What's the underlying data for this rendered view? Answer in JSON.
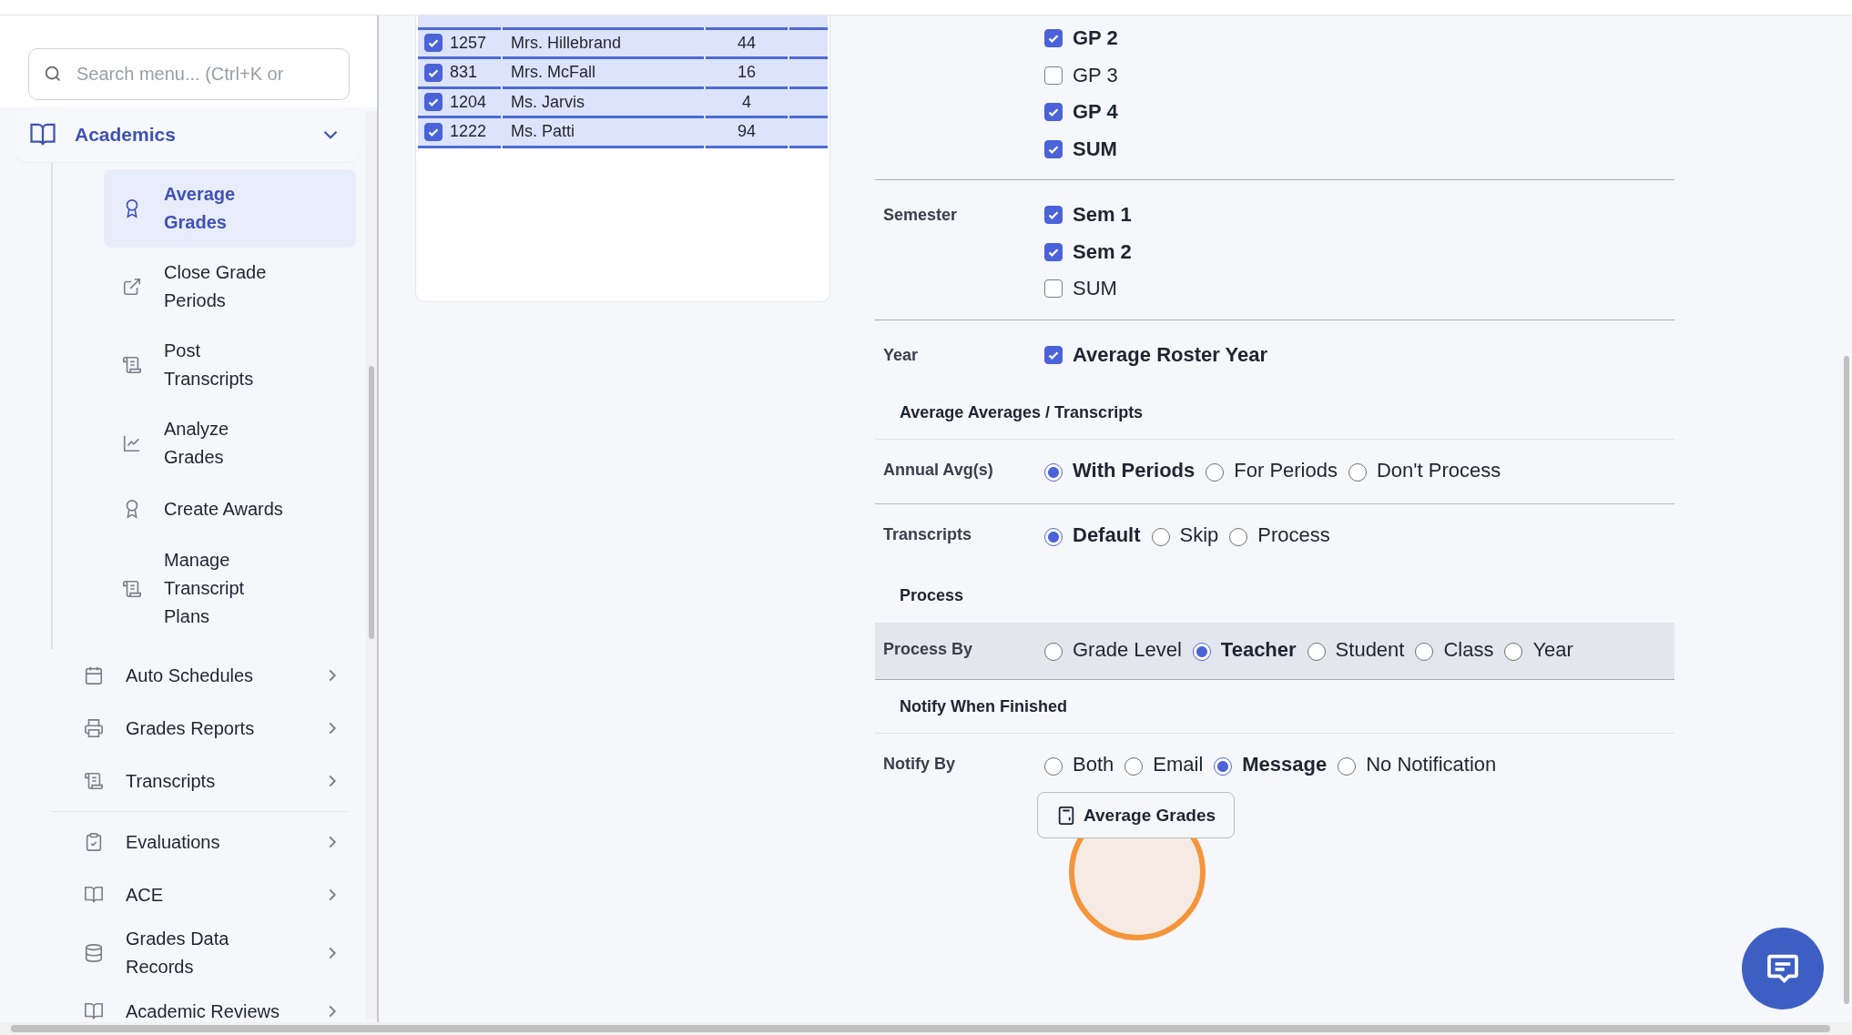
{
  "sidebar": {
    "search": {
      "placeholder": "Search menu... (Ctrl+K or"
    },
    "section": {
      "label": "Academics",
      "expanded": true,
      "children": [
        {
          "label": "Average Grades",
          "selected": true
        },
        {
          "label": "Close Grade Periods",
          "selected": false
        },
        {
          "label": "Post Transcripts",
          "selected": false
        },
        {
          "label": "Analyze Grades",
          "selected": false
        },
        {
          "label": "Create Awards",
          "selected": false
        },
        {
          "label": "Manage Transcript Plans",
          "selected": false
        }
      ]
    },
    "items": [
      {
        "label": "Auto Schedules"
      },
      {
        "label": "Grades Reports"
      },
      {
        "label": "Transcripts"
      },
      {
        "label": "Evaluations"
      },
      {
        "label": "ACE"
      },
      {
        "label": "Grades Data Records"
      },
      {
        "label": "Academic Reviews"
      }
    ]
  },
  "table": {
    "rows": [
      {
        "checked": true,
        "id": "1257",
        "name": "Mrs. Hillebrand",
        "count": "44"
      },
      {
        "checked": true,
        "id": "831",
        "name": "Mrs. McFall",
        "count": "16"
      },
      {
        "checked": true,
        "id": "1204",
        "name": "Ms. Jarvis",
        "count": "4"
      },
      {
        "checked": true,
        "id": "1222",
        "name": "Ms. Patti",
        "count": "94"
      }
    ]
  },
  "form_rows": [
    {
      "kind": "checkboxes",
      "divider": true,
      "options": [
        {
          "label": "GP 2",
          "checked": true
        },
        {
          "label": "GP 3",
          "checked": false
        },
        {
          "label": "GP 4",
          "checked": true
        },
        {
          "label": "SUM",
          "checked": true
        }
      ]
    },
    {
      "kind": "checkboxes",
      "label": "Semester",
      "divider": true,
      "options": [
        {
          "label": "Sem 1",
          "checked": true
        },
        {
          "label": "Sem 2",
          "checked": true
        },
        {
          "label": "SUM",
          "checked": false
        }
      ]
    },
    {
      "kind": "checkboxes",
      "label": "Year",
      "divider": false,
      "options": [
        {
          "label": "Average Roster Year",
          "checked": true
        }
      ]
    },
    {
      "kind": "heading",
      "label": "Average Averages / Transcripts",
      "divider": true
    },
    {
      "kind": "radios",
      "label": "Annual Avg(s)",
      "divider": true,
      "highlighted": false,
      "options": [
        {
          "label": "With Periods",
          "selected": true
        },
        {
          "label": "For Periods",
          "selected": false
        },
        {
          "label": "Don't Process",
          "selected": false
        }
      ]
    },
    {
      "kind": "radios",
      "label": "Transcripts",
      "divider": false,
      "highlighted": false,
      "options": [
        {
          "label": "Default",
          "selected": true
        },
        {
          "label": "Skip",
          "selected": false
        },
        {
          "label": "Process",
          "selected": false
        }
      ]
    },
    {
      "kind": "heading",
      "label": "Process",
      "divider": false
    },
    {
      "kind": "radios",
      "label": "Process By",
      "divider": true,
      "highlighted": true,
      "options": [
        {
          "label": "Grade Level",
          "selected": false
        },
        {
          "label": "Teacher",
          "selected": true
        },
        {
          "label": "Student",
          "selected": false
        },
        {
          "label": "Class",
          "selected": false
        },
        {
          "label": "Year",
          "selected": false
        }
      ]
    },
    {
      "kind": "heading",
      "label": "Notify When Finished",
      "divider": true
    },
    {
      "kind": "radios",
      "label": "Notify By",
      "divider": false,
      "highlighted": false,
      "options": [
        {
          "label": "Both",
          "selected": false
        },
        {
          "label": "Email",
          "selected": false
        },
        {
          "label": "Message",
          "selected": true
        },
        {
          "label": "No Notification",
          "selected": false
        }
      ]
    }
  ],
  "submit_button": {
    "label": "Average Grades"
  }
}
